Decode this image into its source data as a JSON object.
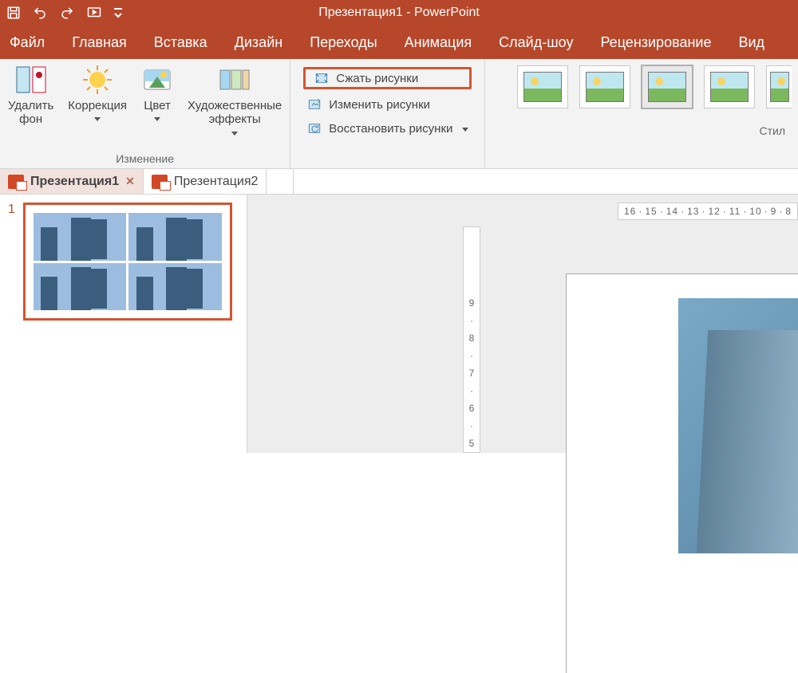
{
  "window": {
    "title": "Презентация1 - PowerPoint"
  },
  "qat_tips": {
    "save": "Save",
    "undo": "Undo",
    "redo": "Redo",
    "start": "Start from beginning",
    "more": "Customize"
  },
  "menu": {
    "file": "Файл",
    "home": "Главная",
    "insert": "Вставка",
    "design": "Дизайн",
    "transitions": "Переходы",
    "animations": "Анимация",
    "slideshow": "Слайд-шоу",
    "review": "Рецензирование",
    "view": "Вид"
  },
  "ribbon": {
    "remove_bg": "Удалить\nфон",
    "corrections": "Коррекция",
    "color": "Цвет",
    "artistic": "Художественные\nэффекты",
    "group_adjust": "Изменение",
    "compress": "Сжать рисунки",
    "change": "Изменить рисунки",
    "reset": "Восстановить рисунки",
    "gallery_label": "Стил"
  },
  "doctabs": {
    "active": "Презентация1",
    "other": "Презентация2"
  },
  "slide": {
    "number": "1"
  },
  "hruler": [
    "16",
    "15",
    "14",
    "13",
    "12",
    "11",
    "10",
    "9",
    "8"
  ],
  "vruler": [
    "9",
    "8",
    "7",
    "6",
    "5"
  ]
}
